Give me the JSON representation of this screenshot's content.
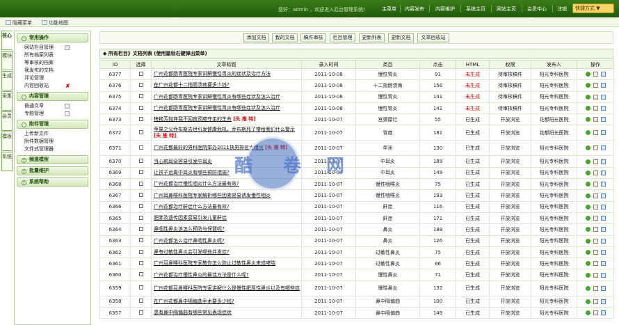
{
  "topbar": {
    "welcome": "您好：admin ，欢迎进入后台管理系统！",
    "nav": [
      "主菜单",
      "内容发布",
      "内容维护",
      "系统主页",
      "网站主页",
      "会员中心",
      "注销"
    ],
    "shortcut": "快捷方式 ▼"
  },
  "subbar": {
    "hide_menu": "隐藏菜单",
    "func_map": "功能地图"
  },
  "vtabs": [
    "核心",
    "模块",
    "生成",
    "采集",
    "会员",
    "模板",
    "系统"
  ],
  "menu": {
    "sections": [
      {
        "title": "常用操作",
        "items": [
          "网站栏目管理",
          "所有档案列表",
          "等审核的档案",
          "我发布的文档",
          "评论管理",
          "内容回收站"
        ]
      },
      {
        "title": "内容管理",
        "items": [
          "普通文章",
          "专题管理"
        ]
      },
      {
        "title": "附件管理",
        "items": [
          "上传新文件",
          "附件数据管理",
          "文件式管理器"
        ]
      },
      {
        "title": "频道模型",
        "items": []
      },
      {
        "title": "批量维护",
        "items": []
      },
      {
        "title": "系统帮助",
        "items": []
      }
    ]
  },
  "toolbar": [
    "添加文档",
    "我的文档",
    "稿件审核",
    "栏目管理",
    "更新列表",
    "更新文档",
    "文章回收站"
  ],
  "table_title": "◆ 所有栏目》文档列表 (使用鼠标右键弹出菜单)",
  "headers": [
    "ID",
    "选择",
    "文章标题",
    "录入时间",
    "类目",
    "点击",
    "HTML",
    "权限",
    "发布人",
    "操作"
  ],
  "hot_label": "[头 推 特]",
  "rows": [
    {
      "id": "6377",
      "title": "广州花都肠胃医院专家讲解慢性胃炎的症状及治疗方法",
      "hot": false,
      "date": "2011-10-08",
      "cat": "慢性胃炎",
      "hits": "91",
      "html": "未生成",
      "perm": "待审核稿件",
      "pub": "阳光专科医院"
    },
    {
      "id": "6376",
      "title": "在广州花都十二指肠溃疡要多少钱?",
      "hot": false,
      "date": "2011-10-08",
      "cat": "十二指肠溃疡",
      "hits": "156",
      "html": "未生成",
      "perm": "待审核稿件",
      "pub": "阳光专科医院"
    },
    {
      "id": "6375",
      "title": "广州花都肠胃医院专家讲解慢性胃炎有哪些症状及怎么治疗",
      "hot": false,
      "date": "2011-10-08",
      "cat": "慢性胃炎",
      "hits": "141",
      "html": "未生成",
      "perm": "待审核稿件",
      "pub": "阳光专科医院"
    },
    {
      "id": "6374",
      "title": "广州花都肠胃医院专家讲解慢性胃炎有哪些症状及怎么治疗",
      "hot": false,
      "date": "2011-10-08",
      "cat": "慢性胃炎",
      "hits": "141",
      "html": "未生成",
      "perm": "待审核稿件",
      "pub": "阳光专科医院"
    },
    {
      "id": "6373",
      "title": "梅艳芳抛弃我不回宫颈癌夺走的生命",
      "hot": true,
      "date": "2011-10-07",
      "cat": "宫颈糜烂",
      "hits": "55",
      "perm": "开放浏览",
      "html": "已生成",
      "pub": "花都阳光医院"
    },
    {
      "id": "6372",
      "title": "苹果之父乔布斯去世引发健康危机，乔布斯死了带给我们什么警示",
      "hot": true,
      "date": "2011-10-07",
      "cat": "胃癌",
      "hits": "181",
      "html": "已生成",
      "perm": "开放浏览",
      "pub": "花都阳光医院"
    },
    {
      "id": "6371",
      "title": "广州花都最好的男科医院举办2011快男排名大曝光",
      "hot": true,
      "date": "2011-10-07",
      "cat": "早泄",
      "hits": "130",
      "html": "已生成",
      "perm": "开放浏览",
      "pub": "阳光专科医院"
    },
    {
      "id": "6370",
      "title": "当心痢耳朵容易引发中耳炎",
      "hot": false,
      "date": "2011-10-07",
      "cat": "中耳炎",
      "hits": "189",
      "html": "已生成",
      "perm": "开放浏览",
      "pub": "阳光专科医院"
    },
    {
      "id": "6369",
      "title": "让孩子远离中耳炎有哪些预防措施?",
      "hot": false,
      "date": "2011-10-07",
      "cat": "中耳炎",
      "hits": "149",
      "html": "已生成",
      "perm": "开放浏览",
      "pub": "阳光专科医院"
    },
    {
      "id": "6368",
      "title": "广州花都治疗慢性咽炎什么方法最有效?",
      "hot": false,
      "date": "2011-10-07",
      "cat": "慢性咽喉炎",
      "hits": "75",
      "html": "已生成",
      "perm": "开放浏览",
      "pub": "阳光专科医院"
    },
    {
      "id": "6367",
      "title": "广州耳鼻喉科医院专家解析哪些因素容易诱发慢性咽炎",
      "hot": false,
      "date": "2011-10-07",
      "cat": "慢性咽喉炎",
      "hits": "193",
      "html": "已生成",
      "perm": "开放浏览",
      "pub": "阳光专科医院"
    },
    {
      "id": "6366",
      "title": "广州花都治疗鼾症什么方法最有效?",
      "hot": false,
      "date": "2011-10-07",
      "cat": "鼾症",
      "hits": "116",
      "html": "已生成",
      "perm": "开放浏览",
      "pub": "阳光专科医院"
    },
    {
      "id": "6365",
      "title": "肥胖及遗传因素容易引发儿童鼾症",
      "hot": false,
      "date": "2011-10-07",
      "cat": "鼾症",
      "hits": "171",
      "html": "已生成",
      "perm": "开放浏览",
      "pub": "阳光专科医院"
    },
    {
      "id": "6364",
      "title": "鼻咽性鼻炎该怎么预防与保健呢?",
      "hot": false,
      "date": "2011-10-07",
      "cat": "鼻炎",
      "hits": "188",
      "html": "已生成",
      "perm": "开放浏览",
      "pub": "阳光专科医院"
    },
    {
      "id": "6363",
      "title": "广州花都怎么治疗鼻咽性鼻炎呢?",
      "hot": false,
      "date": "2011-10-07",
      "cat": "鼻炎",
      "hits": "126",
      "html": "已生成",
      "perm": "开放浏览",
      "pub": "阳光专科医院"
    },
    {
      "id": "6362",
      "title": "鼻有过敏性鼻炎会引发哪些并发症?",
      "hot": false,
      "date": "2011-10-07",
      "cat": "过敏性鼻炎",
      "hits": "75",
      "html": "已生成",
      "perm": "开放浏览",
      "pub": "阳光专科医院"
    },
    {
      "id": "6361",
      "title": "广州耳鼻喉科医院专家教你怎么防止过敏性鼻炎来成哮喘",
      "hot": false,
      "date": "2011-10-07",
      "cat": "过敏性鼻炎",
      "hits": "86",
      "html": "已生成",
      "perm": "开放浏览",
      "pub": "阳光专科医院"
    },
    {
      "id": "6360",
      "title": "广州花都治疗慢性鼻炎的最佳方法是什么呢?",
      "hot": false,
      "date": "2011-10-07",
      "cat": "慢性鼻炎",
      "hits": "71",
      "html": "已生成",
      "perm": "开放浏览",
      "pub": "阳光专科医院"
    },
    {
      "id": "6359",
      "title": "广州花都耳鼻喉科医院专家讲解什么是慢性肥厚性鼻炎以及有哪些症",
      "hot": false,
      "date": "2011-10-07",
      "cat": "慢性鼻炎",
      "hits": "132",
      "html": "已生成",
      "perm": "开放浏览",
      "pub": "阳光专科医院"
    },
    {
      "id": "6358",
      "title": "在广州花都鼻中隔偏曲手术要多少钱?",
      "hot": false,
      "date": "2011-10-07",
      "cat": "鼻中隔偏曲",
      "hits": "100",
      "html": "已生成",
      "perm": "开放浏览",
      "pub": "阳光专科医院"
    },
    {
      "id": "6357",
      "title": "患有鼻中隔偏曲有哪些常见表现症状",
      "hot": false,
      "date": "2011-10-07",
      "cat": "鼻中隔偏曲",
      "hits": "149",
      "html": "已生成",
      "perm": "开放浏览",
      "pub": "阳光专科医院"
    }
  ],
  "watermark": [
    "酷",
    "卷",
    "网"
  ]
}
